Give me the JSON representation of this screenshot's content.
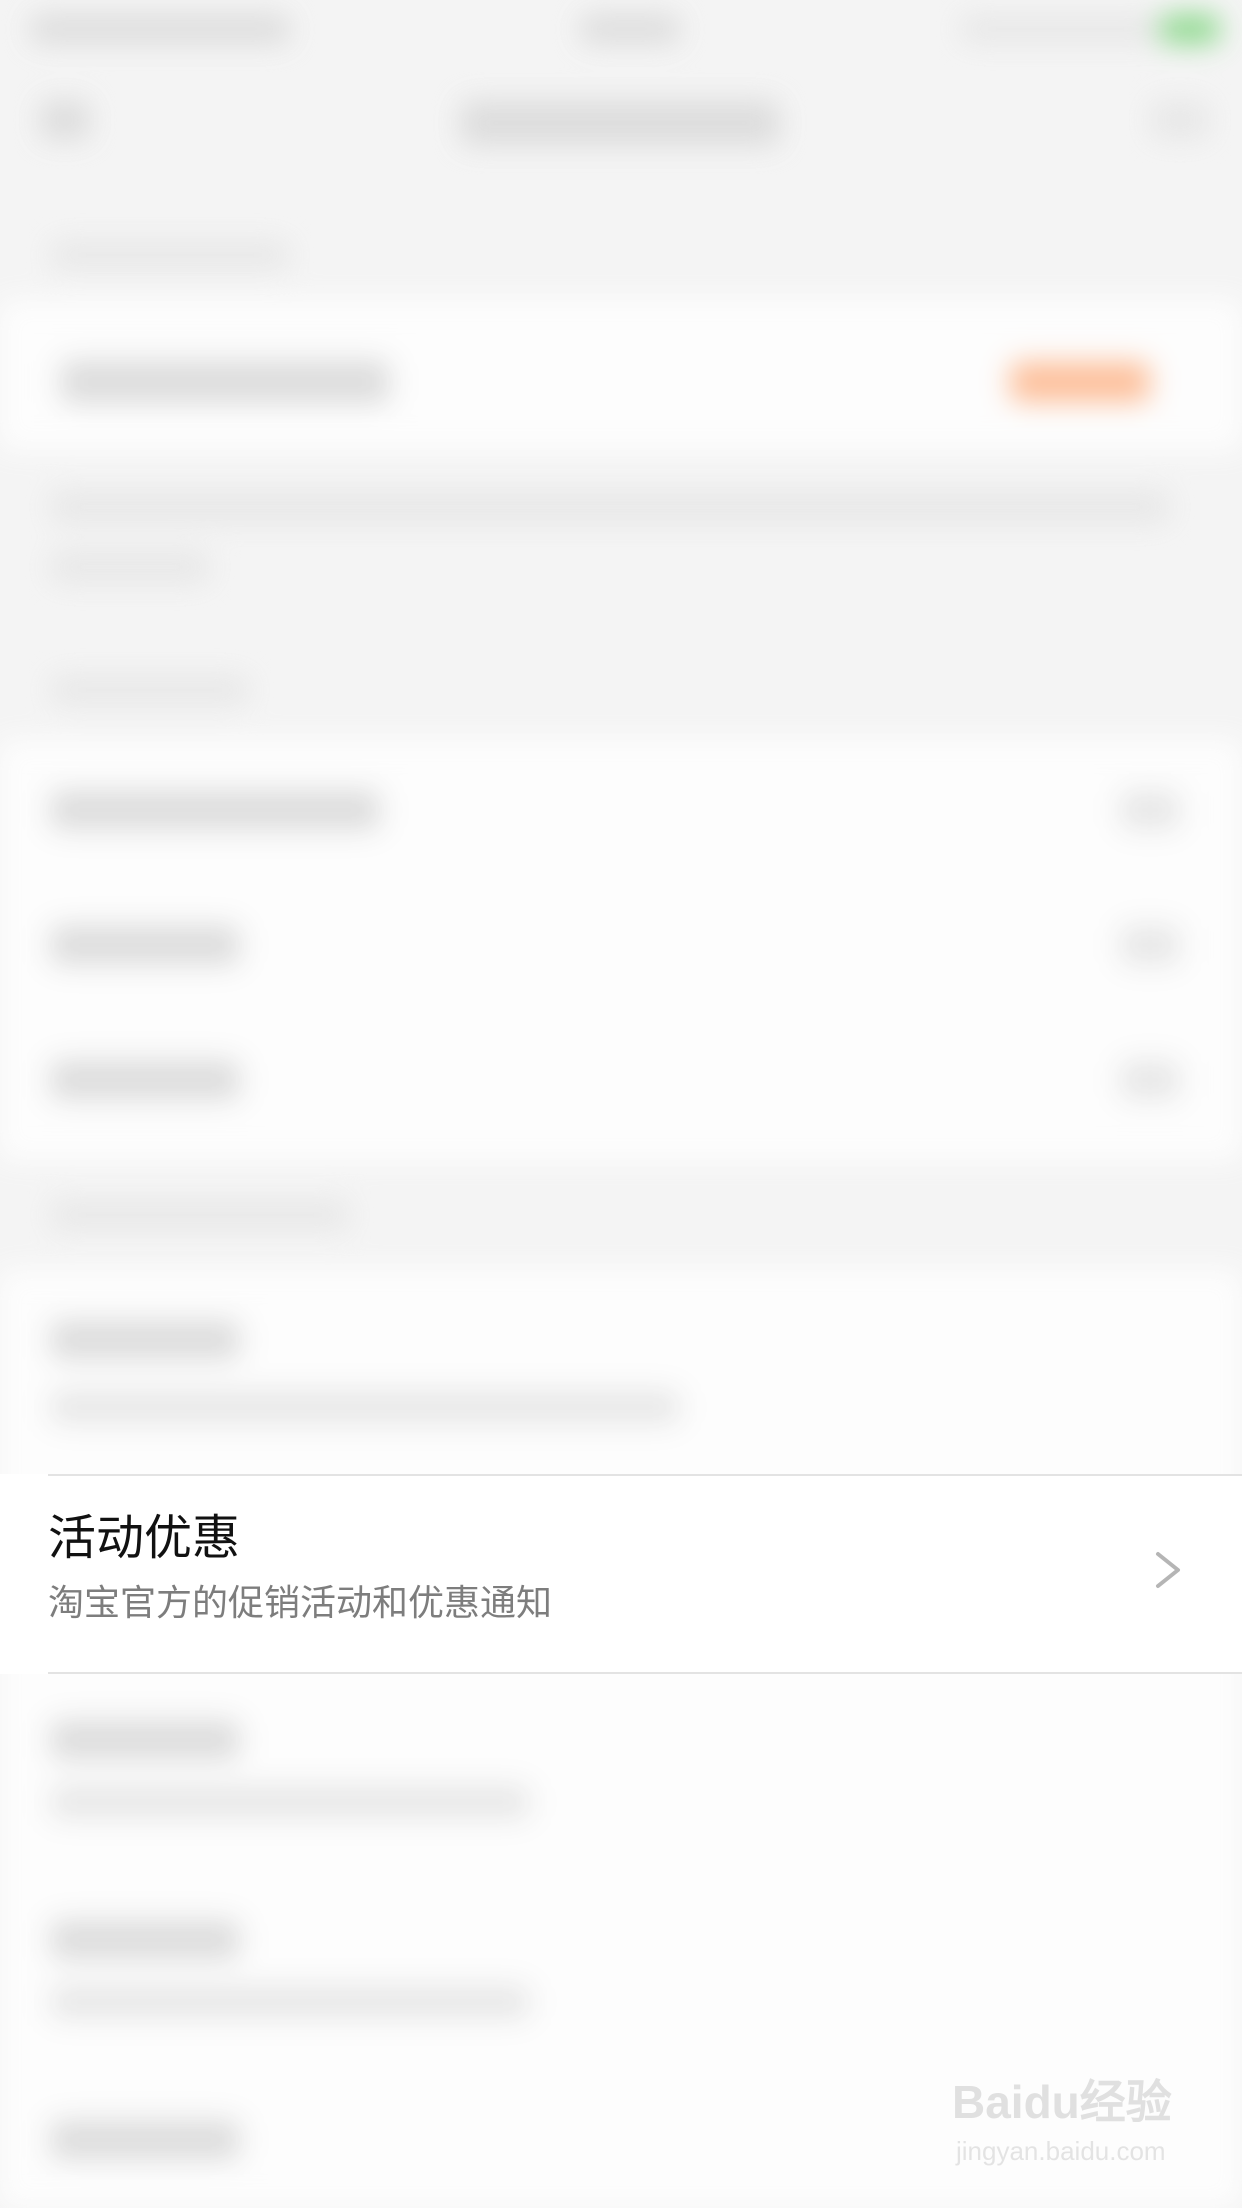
{
  "promo_row": {
    "title": "活动优惠",
    "subtitle": "淘宝官方的促销活动和优惠通知"
  },
  "watermark": {
    "logo": "Baidu经验",
    "url": "jingyan.baidu.com"
  },
  "icons": {
    "chevron": "chevron-right-icon"
  },
  "colors": {
    "title_text": "#111111",
    "subtitle_text": "#7d7d7d",
    "divider": "#e3e3e3",
    "background": "#f4f4f4"
  }
}
